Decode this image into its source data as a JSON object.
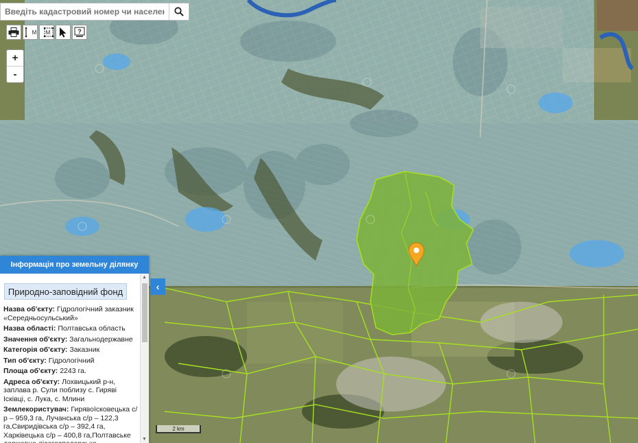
{
  "search": {
    "placeholder": "Введіть кадастровий номер чи населений пун"
  },
  "toolbar": {
    "icons": [
      "printer-icon",
      "measure-distance-icon",
      "measure-area-icon",
      "pointer-icon",
      "help-icon"
    ],
    "measure_letter": "M",
    "help_glyph": "?"
  },
  "zoom": {
    "in_label": "+",
    "out_label": "-"
  },
  "panel": {
    "header": "Інформація про земельну ділянку",
    "section": "Природно-заповідний фонд",
    "rows": [
      {
        "label": "Назва об'єкту:",
        "value": "Гідрологічний заказник «Середньосульський»"
      },
      {
        "label": "Назва області:",
        "value": "Полтавська область"
      },
      {
        "label": "Значення об'єкту:",
        "value": "Загальнодержавне"
      },
      {
        "label": "Категорія об'єкту:",
        "value": "Заказник"
      },
      {
        "label": "Тип об'єкту:",
        "value": "Гідрологічний"
      },
      {
        "label": "Площа об'єкту:",
        "value": "2243 га."
      },
      {
        "label": "Адреса об'єкту:",
        "value": "Лохвицький р-н, заплава р. Сули поблизу с. Гиряві Ісківці, с. Лука, с. Млини"
      },
      {
        "label": "Землекористувач:",
        "value": "Гирявоїсковецька с/р – 959,3 га, Лучанська с/р – 122,3 га,Свиридівська с/р – 392,4 га, Харківецька с/р – 400,8 га,Полтавське державне лісогосподарське"
      }
    ],
    "collapse_glyph": "‹"
  },
  "scale": {
    "label": "2 km"
  },
  "colors": {
    "reserve": "#7bb23a",
    "parcel": "#a8d6f5",
    "boundary": "#a6e01e",
    "river": "#2b62b5",
    "marker": "#f5a623"
  }
}
